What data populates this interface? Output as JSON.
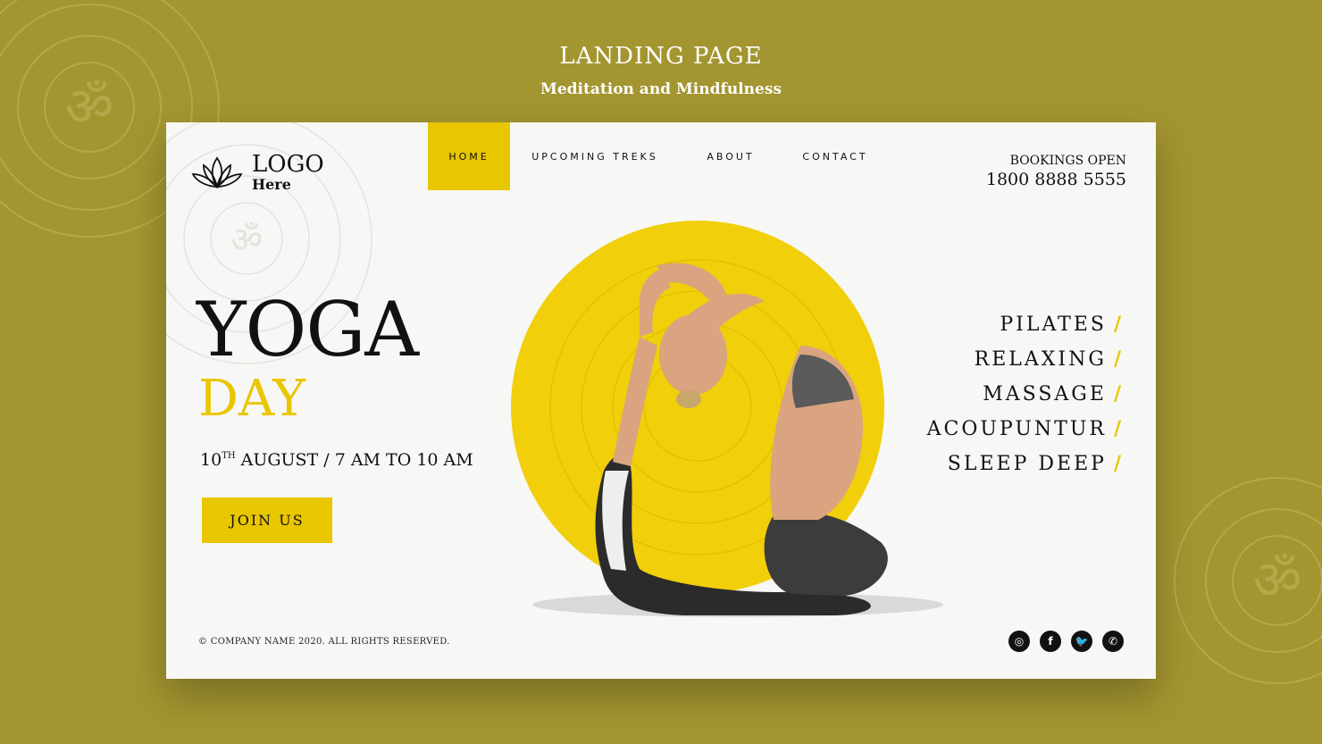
{
  "header": {
    "title": "LANDING PAGE",
    "subtitle": "Meditation and Mindfulness"
  },
  "logo": {
    "main": "LOGO",
    "sub": "Here",
    "icon": "lotus-icon"
  },
  "nav": {
    "items": [
      {
        "label": "HOME",
        "active": true
      },
      {
        "label": "UPCOMING TREKS",
        "active": false
      },
      {
        "label": "ABOUT",
        "active": false
      },
      {
        "label": "CONTACT",
        "active": false
      }
    ]
  },
  "booking": {
    "label": "BOOKINGS OPEN",
    "phone": "1800 8888 5555"
  },
  "hero": {
    "title": "YOGA",
    "subtitle": "DAY",
    "date_day": "10",
    "date_suffix": "TH",
    "date_rest": " AUGUST / 7 AM TO 10 AM",
    "button_label": "JOIN US"
  },
  "services": [
    {
      "label": "PILATES"
    },
    {
      "label": "RELAXING"
    },
    {
      "label": "MASSAGE"
    },
    {
      "label": "ACOUPUNTUR"
    },
    {
      "label": "SLEEP DEEP"
    }
  ],
  "service_separator": "/",
  "footer": {
    "copyright": "© COMPANY NAME 2020. ALL RIGHTS RESERVED."
  },
  "social": [
    {
      "icon": "instagram-icon",
      "glyph": "◎"
    },
    {
      "icon": "facebook-icon",
      "glyph": "f"
    },
    {
      "icon": "twitter-icon",
      "glyph": "🐦"
    },
    {
      "icon": "whatsapp-icon",
      "glyph": "✆"
    }
  ],
  "colors": {
    "background": "#a39530",
    "accent": "#e8c600",
    "card": "#f7f7f5",
    "text": "#111111"
  }
}
